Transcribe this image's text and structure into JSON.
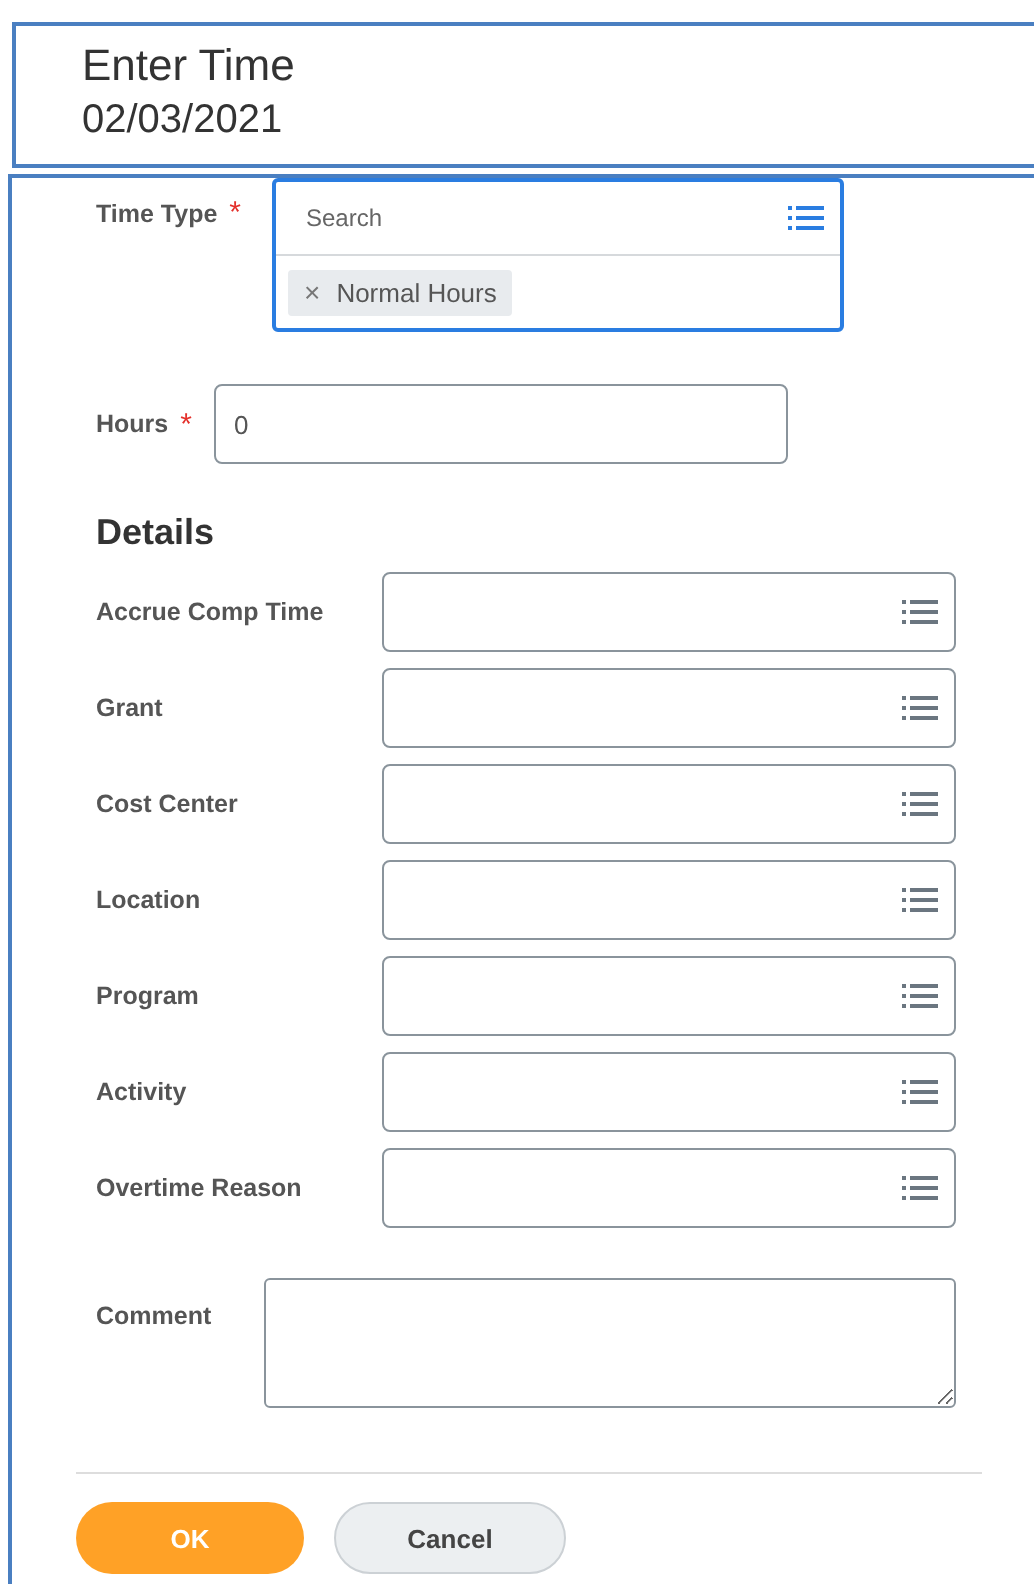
{
  "header": {
    "title": "Enter Time",
    "date": "02/03/2021"
  },
  "time_type": {
    "label": "Time Type",
    "required_mark": "*",
    "placeholder": "Search",
    "selected_items": [
      {
        "label": "Normal Hours",
        "remove": "×"
      }
    ]
  },
  "hours": {
    "label": "Hours",
    "required_mark": "*",
    "value": "0"
  },
  "details": {
    "heading": "Details",
    "fields": [
      {
        "label": "Accrue Comp Time"
      },
      {
        "label": "Grant"
      },
      {
        "label": "Cost Center"
      },
      {
        "label": "Location"
      },
      {
        "label": "Program"
      },
      {
        "label": "Activity"
      },
      {
        "label": "Overtime Reason"
      }
    ]
  },
  "comment": {
    "label": "Comment"
  },
  "buttons": [
    {
      "label": "OK",
      "kind": "primary"
    },
    {
      "label": "Cancel",
      "kind": "secondary"
    }
  ]
}
